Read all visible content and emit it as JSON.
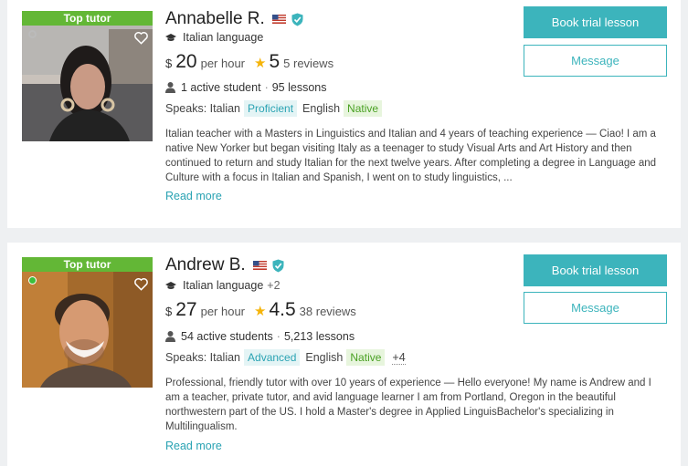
{
  "tutors": [
    {
      "badge": "Top tutor",
      "name": "Annabelle R.",
      "language": "Italian language",
      "extra_languages": "",
      "currency": "$",
      "price": "20",
      "per": "per hour",
      "rating": "5",
      "reviews": "5 reviews",
      "students": "1 active student",
      "lessons": "95 lessons",
      "speaks_label": "Speaks:",
      "spoken": [
        {
          "lang": "Italian",
          "level": "Proficient",
          "color": "blue"
        },
        {
          "lang": "English",
          "level": "Native",
          "color": "green"
        }
      ],
      "more_spoken": "",
      "description": "Italian teacher with a Masters in Linguistics and Italian and 4 years of teaching experience — Ciao! I am a native New Yorker but began visiting Italy as a teenager to study Visual Arts and Art History and then continued to return and study Italian for the next twelve years. After completing a degree in Language and Culture with a focus in Italian and Spanish, I went on to study linguistics, ...",
      "read_more": "Read more",
      "book_label": "Book trial lesson",
      "message_label": "Message",
      "online": false
    },
    {
      "badge": "Top tutor",
      "name": "Andrew B.",
      "language": "Italian language",
      "extra_languages": "+2",
      "currency": "$",
      "price": "27",
      "per": "per hour",
      "rating": "4.5",
      "reviews": "38 reviews",
      "students": "54 active students",
      "lessons": "5,213 lessons",
      "speaks_label": "Speaks:",
      "spoken": [
        {
          "lang": "Italian",
          "level": "Advanced",
          "color": "blue"
        },
        {
          "lang": "English",
          "level": "Native",
          "color": "green"
        }
      ],
      "more_spoken": "+4",
      "description": "Professional, friendly tutor with over 10 years of experience — Hello everyone! My name is Andrew and I am a teacher, private tutor, and avid language learner I am from Portland, Oregon in the beautiful northwestern part of the US. I hold a Master's degree in Applied LinguisBachelor's specializing in Multilingualism.",
      "read_more": "Read more",
      "book_label": "Book trial lesson",
      "message_label": "Message",
      "online": true
    }
  ],
  "colors": {
    "accent": "#3cb4bc",
    "badge": "#63b736",
    "star": "#f5b40a"
  }
}
